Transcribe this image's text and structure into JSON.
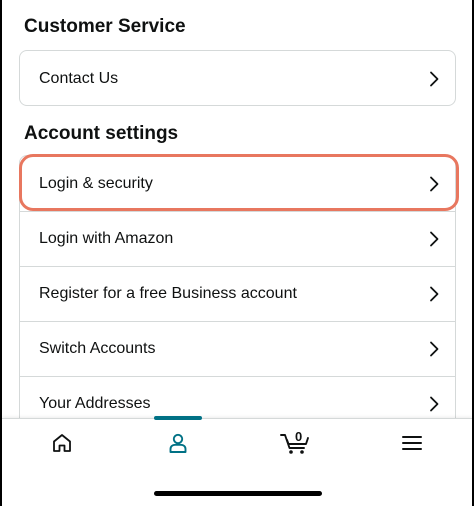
{
  "customer_service": {
    "title": "Customer Service",
    "items": [
      {
        "label": "Contact Us"
      }
    ]
  },
  "account_settings": {
    "title": "Account settings",
    "items": [
      {
        "label": "Login & security",
        "highlighted": true
      },
      {
        "label": "Login with Amazon"
      },
      {
        "label": "Register for a free Business account"
      },
      {
        "label": "Switch Accounts"
      },
      {
        "label": "Your Addresses"
      }
    ]
  },
  "bottom_nav": {
    "items": [
      {
        "icon": "home-icon"
      },
      {
        "icon": "person-icon",
        "active": true
      },
      {
        "icon": "cart-icon",
        "count": "0"
      },
      {
        "icon": "menu-icon"
      }
    ]
  },
  "colors": {
    "highlight": "#e8775f",
    "active": "#007185",
    "text": "#0f1111",
    "border": "#d5d9d9"
  }
}
